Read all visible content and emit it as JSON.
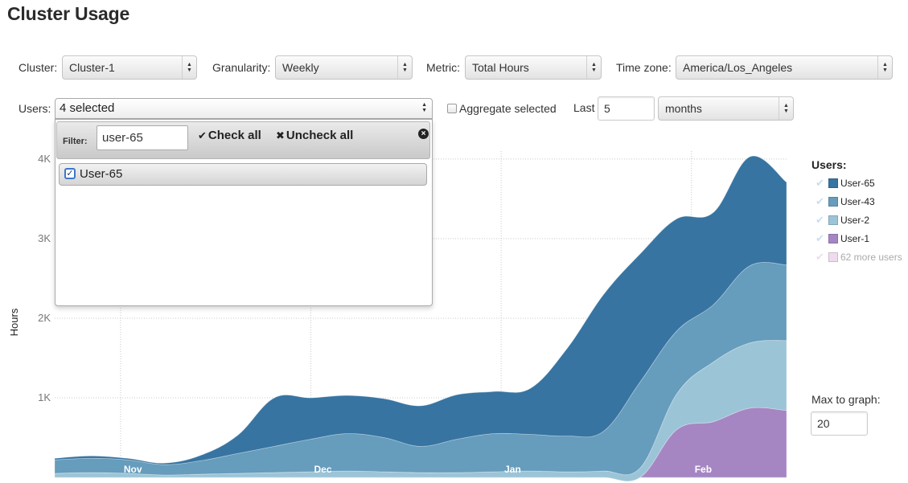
{
  "page": {
    "title": "Cluster Usage"
  },
  "controls": {
    "cluster": {
      "label": "Cluster:",
      "value": "Cluster-1"
    },
    "granularity": {
      "label": "Granularity:",
      "value": "Weekly"
    },
    "metric": {
      "label": "Metric:",
      "value": "Total Hours"
    },
    "timezone": {
      "label": "Time zone:",
      "value": "America/Los_Angeles"
    },
    "users": {
      "label": "Users:",
      "value": "4 selected"
    },
    "aggregate": {
      "label": "Aggregate selected",
      "checked": false
    },
    "last": {
      "label": "Last",
      "value": "5",
      "unit": "months"
    },
    "max_to_graph": {
      "label": "Max to graph:",
      "value": "20"
    }
  },
  "dropdown": {
    "filter_label": "Filter:",
    "filter_value": "user-65",
    "check_all": "Check all",
    "uncheck_all": "Uncheck all",
    "options": [
      {
        "label": "User-65",
        "checked": true
      }
    ]
  },
  "legend": {
    "title": "Users:",
    "items": [
      {
        "label": "User-65",
        "color": "#3774a1"
      },
      {
        "label": "User-43",
        "color": "#669cbc"
      },
      {
        "label": "User-2",
        "color": "#9cc4d7"
      },
      {
        "label": "User-1",
        "color": "#a586c3"
      },
      {
        "label": "62 more users",
        "color": "#eedcee"
      }
    ]
  },
  "chart_data": {
    "type": "area",
    "stacked": true,
    "ylabel": "Hours",
    "yticks": [
      "1K",
      "2K",
      "3K",
      "4K"
    ],
    "ylim": [
      0,
      4100
    ],
    "xlabels": [
      "Nov",
      "Dec",
      "Jan",
      "Feb"
    ],
    "x": [
      "Oct 6",
      "Oct 13",
      "Oct 20",
      "Oct 27",
      "Nov 3",
      "Nov 10",
      "Nov 17",
      "Nov 24",
      "Dec 1",
      "Dec 8",
      "Dec 15",
      "Dec 22",
      "Dec 29",
      "Jan 5",
      "Jan 12",
      "Jan 19",
      "Jan 26",
      "Feb 2",
      "Feb 9",
      "Feb 16",
      "Feb 23"
    ],
    "series": [
      {
        "name": "User-1",
        "color": "#a586c3",
        "values": [
          0,
          0,
          0,
          0,
          0,
          0,
          0,
          0,
          0,
          0,
          0,
          0,
          0,
          0,
          0,
          0,
          0,
          600,
          700,
          870,
          840
        ]
      },
      {
        "name": "User-2",
        "color": "#9cc4d7",
        "values": [
          50,
          60,
          50,
          30,
          40,
          50,
          60,
          70,
          80,
          70,
          60,
          60,
          70,
          80,
          70,
          80,
          120,
          450,
          750,
          820,
          880
        ]
      },
      {
        "name": "User-43",
        "color": "#669cbc",
        "values": [
          170,
          180,
          170,
          130,
          170,
          250,
          330,
          410,
          470,
          430,
          330,
          420,
          480,
          460,
          450,
          500,
          1080,
          790,
          720,
          970,
          950
        ]
      },
      {
        "name": "User-65",
        "color": "#3774a1",
        "values": [
          20,
          30,
          20,
          20,
          70,
          230,
          610,
          520,
          480,
          490,
          510,
          560,
          530,
          580,
          1100,
          1720,
          1610,
          1410,
          1160,
          1370,
          1040
        ]
      },
      {
        "name": "62 more users",
        "color": "#eedcee",
        "values": [
          0,
          0,
          0,
          0,
          0,
          0,
          0,
          0,
          0,
          0,
          0,
          0,
          0,
          0,
          0,
          0,
          0,
          0,
          0,
          0,
          0
        ]
      }
    ]
  }
}
